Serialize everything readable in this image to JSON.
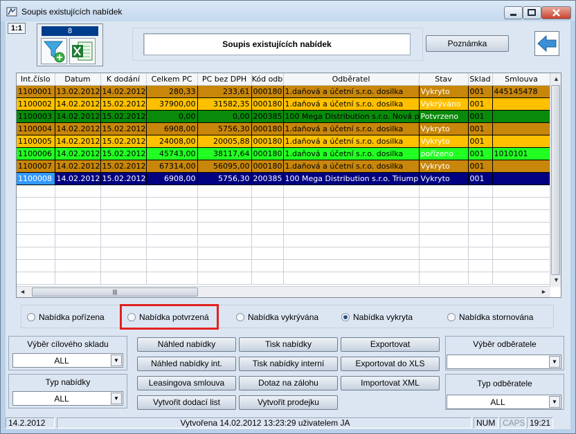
{
  "window": {
    "title": "Soupis existujících nabídek"
  },
  "toolbar": {
    "zoom": "1:1",
    "count": "8",
    "title": "Soupis existujících nabídek",
    "note_button": "Poznámka"
  },
  "grid": {
    "columns": [
      "Int.číslo",
      "Datum",
      "K dodání",
      "Celkem PC",
      "PC bez DPH",
      "Kód odb",
      "Odběratel",
      "Stav",
      "Sklad",
      "Smlouva"
    ],
    "rows": [
      {
        "cells": [
          "1100001",
          "13.02.2012",
          "14.02.2012",
          "280,33",
          "233,61",
          "000180",
          "1.daňová a účetní s.r.o. dosilka",
          "Vykryto",
          "001",
          "445145478"
        ],
        "bg": "#c8860a",
        "fg": "#000000",
        "stav_fg": "#ffffff"
      },
      {
        "cells": [
          "1100002",
          "14.02.2012",
          "15.02.2012",
          "37900,00",
          "31582,35",
          "000180",
          "1.daňová a účetní s.r.o. dosilka",
          "Vykrýváno",
          "001",
          ""
        ],
        "bg": "#ffc000",
        "fg": "#000000",
        "stav_fg": "#ffffff"
      },
      {
        "cells": [
          "1100003",
          "14.02.2012",
          "15.02.2012",
          "0,00",
          "0,00",
          "200385",
          "100 Mega Distribution s.r.o. Nová p",
          "Potvrzeno",
          "001",
          ""
        ],
        "bg": "#0a8a0a",
        "fg": "#000000",
        "stav_fg": "#ffffff"
      },
      {
        "cells": [
          "1100004",
          "14.02.2012",
          "15.02.2012",
          "6908,00",
          "5756,30",
          "000180",
          "1.daňová a účetní s.r.o. dosilka",
          "Vykryto",
          "001",
          ""
        ],
        "bg": "#c8860a",
        "fg": "#000000",
        "stav_fg": "#ffffff"
      },
      {
        "cells": [
          "1100005",
          "14.02.2012",
          "15.02.2012",
          "24008,00",
          "20005,88",
          "000180",
          "1.daňová a účetní s.r.o. dosilka",
          "Vykryto",
          "001",
          ""
        ],
        "bg": "#ffc000",
        "fg": "#000000",
        "stav_fg": "#ffffff"
      },
      {
        "cells": [
          "1100006",
          "14.02.2012",
          "15.02.2012",
          "45743,00",
          "38117,64",
          "000180",
          "1.daňová a účetní s.r.o. dosilka",
          "pořízeno",
          "001",
          "1010101"
        ],
        "bg": "#22ff22",
        "fg": "#000000",
        "stav_fg": "#ffffff"
      },
      {
        "cells": [
          "1100007",
          "14.02.2012",
          "15.02.2012",
          "67314,00",
          "56095,00",
          "000180",
          "1.daňová a účetní s.r.o. dosilka",
          "Vykryto",
          "001",
          ""
        ],
        "bg": "#c8860a",
        "fg": "#000000",
        "stav_fg": "#ffffff"
      },
      {
        "cells": [
          "1100008",
          "14.02.2012",
          "15.02.2012",
          "6908,00",
          "5756,30",
          "200385",
          "100 Mega Distribution s.r.o. Triump",
          "Vykryto",
          "001",
          ""
        ],
        "bg": "#000080",
        "fg": "#ffffff",
        "stav_fg": "#ffffff",
        "selected": true
      }
    ],
    "empty_rows": 8
  },
  "filters": {
    "options": [
      {
        "label": "Nabídka pořízena",
        "checked": false
      },
      {
        "label": "Nabídka potvrzená",
        "checked": false
      },
      {
        "label": "Nabídka vykrývána",
        "checked": false
      },
      {
        "label": "Nabídka vykryta",
        "checked": true
      },
      {
        "label": "Nabídka stornována",
        "checked": false
      }
    ]
  },
  "left_panel": {
    "warehouse_label": "Výběr cílového skladu",
    "warehouse_value": "ALL",
    "type_label": "Typ nabídky",
    "type_value": "ALL"
  },
  "actions": {
    "preview": "Náhled nabídky",
    "preview_int": "Náhled nabídky int.",
    "leasing": "Leasingova smlouva",
    "delivery": "Vytvořit dodací list",
    "print": "Tisk nabídky",
    "print_int": "Tisk nabídky interní",
    "deposit": "Dotaz na zálohu",
    "sale": "Vytvořit prodejku",
    "export": "Exportovat",
    "export_xls": "Exportovat do XLS",
    "import_xml": "Importovat XML"
  },
  "right_panel": {
    "customer_label": "Výběr odběratele",
    "customer_value": "",
    "customer_type_label": "Typ odběratele",
    "customer_type_value": "ALL"
  },
  "status": {
    "date": "14.2.2012",
    "message": "Vytvořena 14.02.2012 13:23:29 uživatelem JA",
    "num": "NUM",
    "caps": "CAPS",
    "time": "19:21"
  },
  "colors": {
    "highlight": "#e02020",
    "selected_row": "#000080"
  }
}
